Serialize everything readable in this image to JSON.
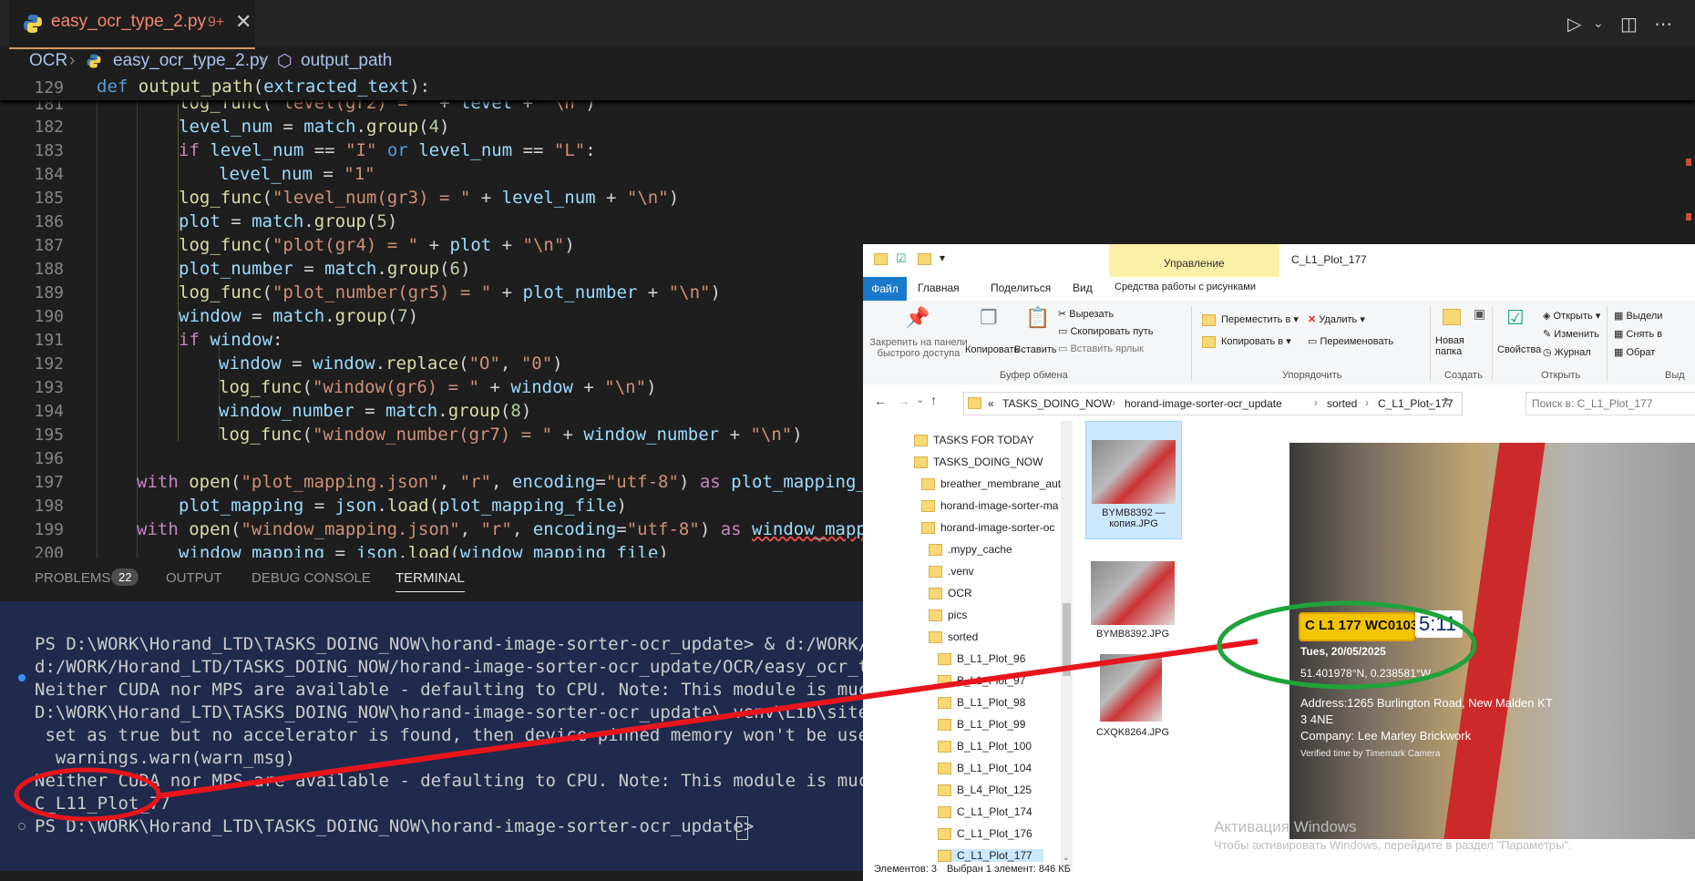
{
  "vscode": {
    "tab": {
      "filename": "easy_ocr_type_2.py",
      "count": "9+",
      "close": "✕"
    },
    "breadcrumb": {
      "folder": "OCR",
      "file": "easy_ocr_type_2.py",
      "symbol": "output_path"
    },
    "sticky": {
      "line": "129",
      "code": "def output_path(extracted_text):"
    },
    "lines": [
      "181",
      "182",
      "183",
      "184",
      "185",
      "186",
      "187",
      "188",
      "189",
      "190",
      "191",
      "192",
      "193",
      "194",
      "195",
      "196",
      "197",
      "198",
      "199",
      "200"
    ],
    "panel_tabs": {
      "problems": "PROBLEMS",
      "problems_count": "22",
      "output": "OUTPUT",
      "debug": "DEBUG CONSOLE",
      "terminal": "TERMINAL"
    },
    "terminal_lines": [
      "PS D:\\WORK\\Horand_LTD\\TASKS_DOING_NOW\\horand-image-sorter-ocr_update> & d:/WORK/Hor",
      "d:/WORK/Horand_LTD/TASKS_DOING_NOW/horand-image-sorter-ocr_update/OCR/easy_ocr_type",
      "Neither CUDA nor MPS are available - defaulting to CPU. Note: This module is much f",
      "D:\\WORK\\Horand_LTD\\TASKS_DOING_NOW\\horand-image-sorter-ocr_update\\.venv\\Lib\\site-p",
      " set as true but no accelerator is found, then device pinned memory won't be used.",
      "  warnings.warn(warn_msg)",
      "Neither CUDA nor MPS are available - defaulting to CPU. Note: This module is much f",
      "C_L11_Plot_77",
      "PS D:\\WORK\\Horand_LTD\\TASKS_DOING_NOW\\horand-image-sorter-ocr_update> "
    ]
  },
  "explorer": {
    "title": "C_L1_Plot_177",
    "manage_tab": "Управление",
    "tabs": [
      "Файл",
      "Главная",
      "Поделиться",
      "Вид",
      "Средства работы с рисунками"
    ],
    "ribbon": {
      "pin": "Закрепить на панели быстрого доступа",
      "copy": "Копировать",
      "paste": "Вставить",
      "cut": "Вырезать",
      "copy_path": "Скопировать путь",
      "paste_shortcut": "Вставить ярлык",
      "clipboard": "Буфер обмена",
      "move_to": "Переместить в",
      "copy_to": "Копировать в",
      "delete": "Удалить",
      "rename": "Переименовать",
      "organize": "Упорядочить",
      "new_folder": "Новая папка",
      "create": "Создать",
      "properties": "Свойства",
      "open": "Открыть",
      "edit": "Изменить",
      "history": "Журнал",
      "open_group": "Открыть",
      "select_all": "Выдели",
      "select_none": "Снять в",
      "invert": "Обрат",
      "select_group": "Выд"
    },
    "address": [
      "«",
      "TASKS_DOING_NOW",
      "horand-image-sorter-ocr_update",
      "sorted",
      "C_L1_Plot_177"
    ],
    "search_placeholder": "Поиск в: C_L1_Plot_177",
    "tree": [
      "TASKS FOR TODAY",
      "TASKS_DOING_NOW",
      "breather_membrane_aut",
      "horand-image-sorter-ma",
      "horand-image-sorter-oc",
      ".mypy_cache",
      ".venv",
      "OCR",
      "pics",
      "sorted",
      "B_L1_Plot_96",
      "B_L1_Plot_97",
      "B_L1_Plot_98",
      "B_L1_Plot_99",
      "B_L1_Plot_100",
      "B_L1_Plot_104",
      "B_L4_Plot_125",
      "C_L1_Plot_174",
      "C_L1_Plot_176",
      "C_L1_Plot_177"
    ],
    "files": [
      "BYMB8392 — копия.JPG",
      "BYMB8392.JPG",
      "CXQK8264.JPG"
    ],
    "preview": {
      "plate": "C L1 177 WC0103",
      "time": "5:11",
      "date": "Tues, 20/05/2025",
      "coords": "51.401978°N, 0.238581°W",
      "address": "Address:1265 Burlington Road, New Malden KT",
      "address2": "3 4NE",
      "company": "Company: Lee Marley Brickwork",
      "verified": "Verified time by Timemark Camera"
    },
    "status_items": "Элементов: 3",
    "status_selected": "Выбран 1 элемент: 846 КБ"
  },
  "activation": {
    "title": "Активация Windows",
    "subtitle": "Чтобы активировать Windows, перейдите в раздел \"Параметры\"."
  }
}
